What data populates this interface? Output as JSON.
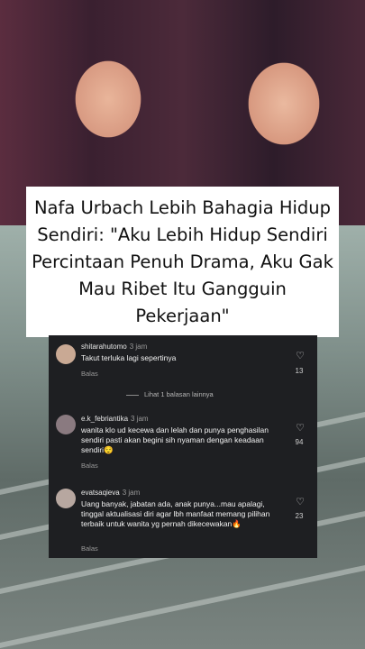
{
  "headline": "Nafa Urbach Lebih Bahagia Hidup Sendiri: \"Aku Lebih Hidup Sendiri Percintaan Penuh Drama, Aku Gak Mau Ribet Itu Gangguin Pekerjaan\"",
  "comments": [
    {
      "username": "shitarahutomo",
      "time": "3 jam",
      "text": "Takut terluka lagi sepertinya",
      "reply_label": "Balas",
      "likes": "13"
    },
    {
      "username": "e.k_febriantika",
      "time": "3 jam",
      "text": "wanita klo ud kecewa dan lelah dan punya penghasilan sendiri pasti akan begini sih nyaman dengan keadaan sendiri😌",
      "reply_label": "Balas",
      "likes": "94"
    },
    {
      "username": "evatsaqieva",
      "time": "3 jam",
      "text": "Uang banyak, jabatan ada, anak punya...mau apalagi, tinggal aktualisasi diri agar lbh manfaat memang pilihan terbaik untuk wanita yg pernah dikecewakan🔥",
      "reply_label": "Balas",
      "likes": "23"
    }
  ],
  "view_more_replies": "Lihat 1 balasan lainnya",
  "icons": {
    "like": "heart-outline-icon"
  }
}
